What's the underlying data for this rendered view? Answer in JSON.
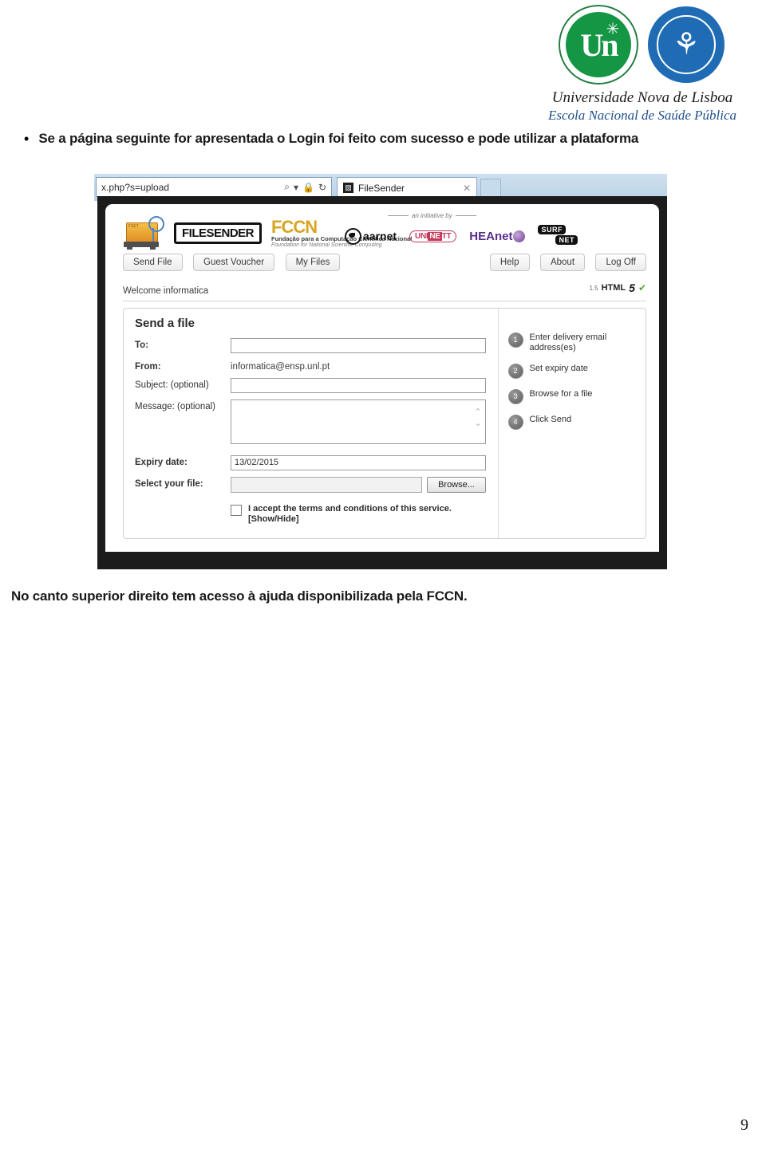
{
  "document": {
    "page_number": "9",
    "bullet_marker": "•",
    "bullet_text": "Se a página seguinte for apresentada o Login foi feito com sucesso e pode utilizar a plataforma",
    "caption": "No canto superior direito tem acesso à ajuda disponibilizada pela FCCN."
  },
  "letterhead": {
    "seal_unl_text": "Un",
    "seal_unl_spark": "✳",
    "seal_ensp_figure": "⚘",
    "university": "Universidade Nova de Lisboa",
    "school": "Escola Nacional de Saúde Pública",
    "colors": {
      "unl_green": "#149644",
      "ensp_blue": "#1f6cb4"
    }
  },
  "browser": {
    "address_value": "x.php?s=upload",
    "address_icons": [
      "search-icon",
      "chevron-down-icon",
      "lock-icon",
      "refresh-icon"
    ],
    "search_glyph": "⌕",
    "chevron_glyph": "▾",
    "lock_glyph": "🔒",
    "refresh_glyph": "↻",
    "tab_favicon": "▨",
    "tab_label": "FileSender",
    "tab_close": "✕"
  },
  "app": {
    "logo_name": "FILESENDER",
    "package_label": "FSET",
    "fccn": {
      "mark": "FCCN",
      "line1": "Fundação para a Computação Científica Nacional",
      "line2": "Foundation for National Scientific Computing"
    },
    "initiative_label": "an initiative by",
    "partners": [
      {
        "name": "aarnet",
        "label": "aarnet"
      },
      {
        "name": "uninett",
        "label_pre": "UNI",
        "label_mid": "NE",
        "label_post": "TT"
      },
      {
        "name": "heanet",
        "label": "HEAnet"
      },
      {
        "name": "surfnet",
        "label_top": "SURF",
        "label_bottom": "NET"
      }
    ],
    "nav_left": [
      "Send File",
      "Guest Voucher",
      "My Files"
    ],
    "nav_right": [
      "Help",
      "About",
      "Log Off"
    ],
    "welcome": "Welcome informatica",
    "version": {
      "number": "1.5",
      "html": "HTML",
      "five": "5",
      "check": "✔"
    }
  },
  "form": {
    "title": "Send a file",
    "to_label": "To:",
    "to_value": "",
    "from_label": "From:",
    "from_value": "informatica@ensp.unl.pt",
    "subject_label": "Subject: (optional)",
    "subject_value": "",
    "message_label": "Message: (optional)",
    "message_value": "",
    "message_scroll_up": "⌃",
    "message_scroll_down": "⌄",
    "expiry_label": "Expiry date:",
    "expiry_value": "13/02/2015",
    "file_label": "Select your file:",
    "file_value": "",
    "browse_label": "Browse...",
    "terms_line1": "I accept the terms and conditions of this service.",
    "terms_line2": "[Show/Hide]"
  },
  "steps": [
    {
      "num": "1",
      "label": "Enter delivery email address(es)"
    },
    {
      "num": "2",
      "label": "Set expiry date"
    },
    {
      "num": "3",
      "label": "Browse for a file"
    },
    {
      "num": "4",
      "label": "Click Send"
    }
  ]
}
